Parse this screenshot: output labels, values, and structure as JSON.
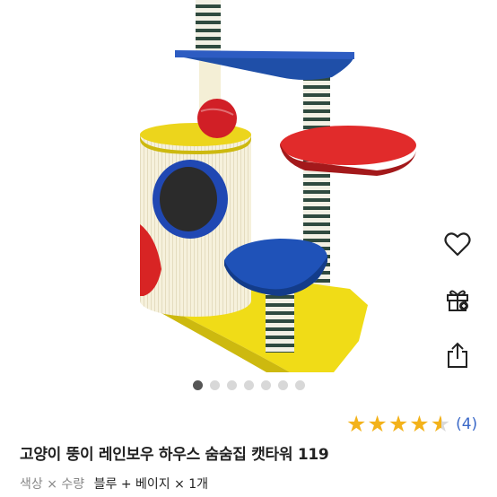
{
  "product": {
    "title": "고양이 뚱이 레인보우 하우스 숨숨집 캣타워 119",
    "image_alt": "캣타워 제품 사진"
  },
  "carousel": {
    "total": 7,
    "active_index": 0
  },
  "actions": {
    "wishlist_icon": "heart-outline-icon",
    "gift_icon": "gift-box-icon",
    "share_icon": "share-upload-icon"
  },
  "rating": {
    "stars": 4.5,
    "review_count": "(4)",
    "star_color": "#f3b21a"
  },
  "option": {
    "label": "색상 × 수량",
    "value": "블루 + 베이지 × 1개"
  }
}
